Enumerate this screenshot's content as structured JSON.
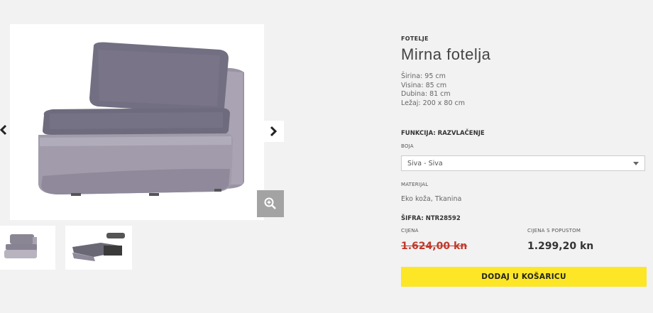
{
  "product": {
    "category": "FOTELJE",
    "title": "Mirna fotelja",
    "specs": [
      "Širina: 95 cm",
      "Visina: 85 cm",
      "Dubina: 81 cm",
      "Ležaj: 200 x 80 cm"
    ],
    "function_label": "FUNKCIJA: RAZVLAČENJE",
    "color_label": "BOJA",
    "color_selected": "Siva - Siva",
    "material_label": "MATERIJAL",
    "material_value": "Eko koža, Tkanina",
    "sku": "ŠIFRA: NTR28592",
    "price_label": "CIJENA",
    "discount_label": "CIJENA S POPUSTOM",
    "old_price": "1.624,00 kn",
    "new_price": "1.299,20 kn",
    "add_to_cart": "DODAJ U KOŠARICU"
  },
  "gallery": {
    "prev_icon": "chevron-left-icon",
    "next_icon": "chevron-right-icon",
    "zoom_icon": "zoom-in-icon"
  },
  "colors": {
    "background": "#f2f2f2",
    "button": "#fce626",
    "old_price": "#c0392b",
    "zoom": "#a3a3a3"
  }
}
